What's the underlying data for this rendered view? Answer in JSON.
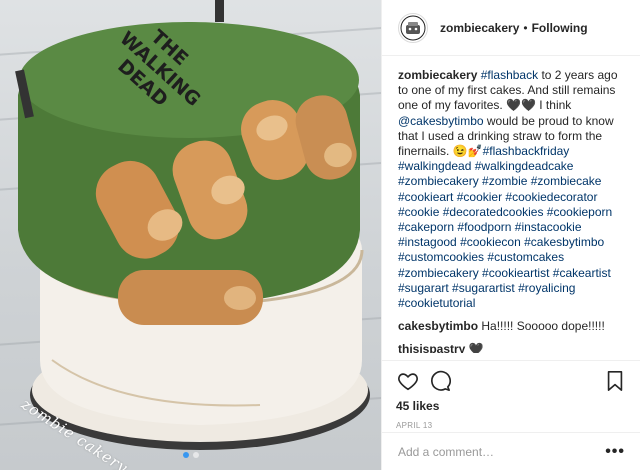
{
  "post": {
    "username": "zombiecakery",
    "separator": "•",
    "follow_label": "Following",
    "caption_user": "zombiecakery",
    "caption_segments": [
      {
        "t": "text",
        "v": " "
      },
      {
        "t": "tag",
        "v": "#flashback"
      },
      {
        "t": "text",
        "v": " to 2 years ago to one of my first cakes. And still remains one of my favorites. 🖤🖤 I think "
      },
      {
        "t": "tag",
        "v": "@cakesbytimbo"
      },
      {
        "t": "text",
        "v": " would be proud to know that I used a drinking straw to form the finernails. 😉💅"
      },
      {
        "t": "tag",
        "v": "#flashbackfriday"
      },
      {
        "t": "text",
        "v": " "
      },
      {
        "t": "tag",
        "v": "#walkingdead"
      },
      {
        "t": "text",
        "v": " "
      },
      {
        "t": "tag",
        "v": "#walkingdeadcake"
      },
      {
        "t": "text",
        "v": " "
      },
      {
        "t": "tag",
        "v": "#zombiecakery"
      },
      {
        "t": "text",
        "v": " "
      },
      {
        "t": "tag",
        "v": "#zombie"
      },
      {
        "t": "text",
        "v": " "
      },
      {
        "t": "tag",
        "v": "#zombiecake"
      },
      {
        "t": "text",
        "v": " "
      },
      {
        "t": "tag",
        "v": "#cookieart"
      },
      {
        "t": "text",
        "v": " "
      },
      {
        "t": "tag",
        "v": "#cookier"
      },
      {
        "t": "text",
        "v": " "
      },
      {
        "t": "tag",
        "v": "#cookiedecorator"
      },
      {
        "t": "text",
        "v": " "
      },
      {
        "t": "tag",
        "v": "#cookie"
      },
      {
        "t": "text",
        "v": " "
      },
      {
        "t": "tag",
        "v": "#decoratedcookies"
      },
      {
        "t": "text",
        "v": " "
      },
      {
        "t": "tag",
        "v": "#cookieporn"
      },
      {
        "t": "text",
        "v": " "
      },
      {
        "t": "tag",
        "v": "#cakeporn"
      },
      {
        "t": "text",
        "v": " "
      },
      {
        "t": "tag",
        "v": "#foodporn"
      },
      {
        "t": "text",
        "v": " "
      },
      {
        "t": "tag",
        "v": "#instacookie"
      },
      {
        "t": "text",
        "v": " "
      },
      {
        "t": "tag",
        "v": "#instagood"
      },
      {
        "t": "text",
        "v": " "
      },
      {
        "t": "tag",
        "v": "#cookiecon"
      },
      {
        "t": "text",
        "v": " "
      },
      {
        "t": "tag",
        "v": "#cakesbytimbo"
      },
      {
        "t": "text",
        "v": " "
      },
      {
        "t": "tag",
        "v": "#customcookies"
      },
      {
        "t": "text",
        "v": " "
      },
      {
        "t": "tag",
        "v": "#customcakes"
      },
      {
        "t": "text",
        "v": " "
      },
      {
        "t": "tag",
        "v": "#zombiecakery"
      },
      {
        "t": "text",
        "v": " "
      },
      {
        "t": "tag",
        "v": "#cookieartist"
      },
      {
        "t": "text",
        "v": " "
      },
      {
        "t": "tag",
        "v": "#cakeartist"
      },
      {
        "t": "text",
        "v": " "
      },
      {
        "t": "tag",
        "v": "#sugarart"
      },
      {
        "t": "text",
        "v": " "
      },
      {
        "t": "tag",
        "v": "#sugarartist"
      },
      {
        "t": "text",
        "v": " "
      },
      {
        "t": "tag",
        "v": "#royalicing"
      },
      {
        "t": "text",
        "v": " "
      },
      {
        "t": "tag",
        "v": "#cookietutorial"
      }
    ],
    "comments": [
      {
        "user": "cakesbytimbo",
        "text": " Ha!!!!! Sooooo dope!!!!!"
      },
      {
        "user": "thisispastry",
        "text": " 🖤"
      }
    ],
    "likes": "45 likes",
    "date": "APRIL 13",
    "add_comment_placeholder": "Add a comment…",
    "more_label": "•••"
  },
  "image": {
    "cake_text": [
      "THE",
      "WALKING",
      "DEAD"
    ],
    "watermark": "zombie cakery",
    "carousel_dots": 2,
    "active_dot": 0
  },
  "icons": {
    "avatar": "zombiecakery-logo-icon",
    "like": "heart-icon",
    "comment": "comment-bubble-icon",
    "save": "bookmark-icon"
  },
  "colors": {
    "link": "#003569",
    "text": "#262626",
    "muted": "#999999",
    "border": "#efefef"
  }
}
